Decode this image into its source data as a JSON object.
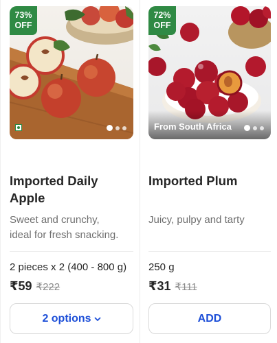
{
  "products": [
    {
      "discount_badge": "73%\nOFF",
      "discount_pct": "73%",
      "discount_off": "OFF",
      "name_line1": "Imported Daily",
      "name_line2": "Apple",
      "description_line1": "Sweet and crunchy,",
      "description_line2": "ideal for fresh snacking.",
      "quantity": "2 pieces x 2 (400 - 800 g)",
      "price": "₹59",
      "mrp": "₹222",
      "action_label": "2 options",
      "action_icon": "chevron-down-icon",
      "veg_indicator": "veg-icon",
      "carousel_dots": 3,
      "carousel_active_index": 0
    },
    {
      "discount_pct": "72%",
      "discount_off": "OFF",
      "name_line1": "Imported Plum",
      "description_line1": "Juicy, pulpy and tarty",
      "origin_tag": "From South Africa",
      "quantity": "250 g",
      "price": "₹31",
      "mrp": "₹111",
      "action_label": "ADD",
      "carousel_dots": 3,
      "carousel_active_index": 0
    }
  ],
  "colors": {
    "badge_green": "#2f8a44",
    "action_blue": "#1d4fd8",
    "text_dark": "#262626",
    "text_muted": "#6f6f6f",
    "mrp_grey": "#8a8a8a"
  }
}
